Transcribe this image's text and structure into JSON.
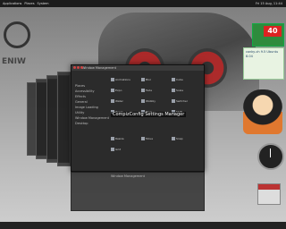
{
  "topbar": {
    "items": [
      "Applications",
      "Places",
      "System"
    ],
    "clock": "Fri 15 Aug, 11:44"
  },
  "window": {
    "title": "Window Management",
    "sidebar": [
      "Places",
      "Accessibility",
      "Effects",
      "General",
      "Image Loading",
      "Utility",
      "Window Management",
      "Desktop"
    ],
    "icons": [
      "Animations",
      "Blur",
      "Cube",
      "Expo",
      "Fade",
      "Scale",
      "Water",
      "Wobbly",
      "Switcher",
      "Zoom",
      "Ring",
      "Shift",
      "Resize",
      "Move",
      "Snap",
      "Grid"
    ],
    "popup": "CompizConfig Settings Manager"
  },
  "lower": {
    "label": "Window Management"
  },
  "widgets": {
    "temperature": "40",
    "note": "conky-ch 9.5 Ubuntu 8.04"
  },
  "colors": {
    "accent": "#b01818",
    "widget_green": "#2e8b3d"
  }
}
